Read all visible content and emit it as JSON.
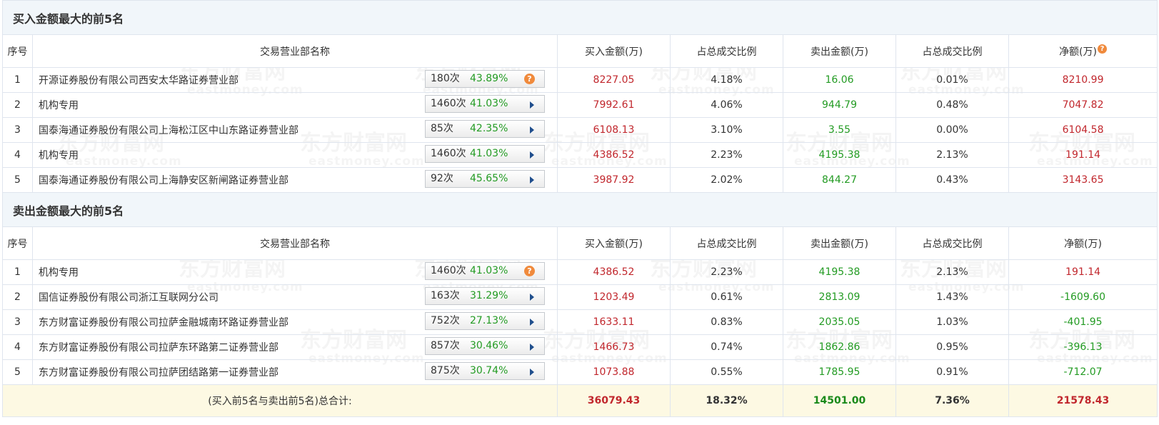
{
  "watermark": {
    "cn": "东方财富网",
    "en": "eastmoney.com"
  },
  "buy_section": {
    "title": "买入金额最大的前5名",
    "headers": [
      "序号",
      "交易营业部名称",
      "买入金额(万)",
      "占总成交比例",
      "卖出金额(万)",
      "占总成交比例",
      "净额(万)"
    ],
    "rows": [
      {
        "rank": "1",
        "name": "开源证券股份有限公司西安太华路证券营业部",
        "count": "180次",
        "pct": "43.89%",
        "btn": "help",
        "buy": "8227.05",
        "buy_ratio": "4.18%",
        "sell": "16.06",
        "sell_ratio": "0.01%",
        "net": "8210.99"
      },
      {
        "rank": "2",
        "name": "机构专用",
        "count": "1460次",
        "pct": "41.03%",
        "btn": "arrow",
        "buy": "7992.61",
        "buy_ratio": "4.06%",
        "sell": "944.79",
        "sell_ratio": "0.48%",
        "net": "7047.82"
      },
      {
        "rank": "3",
        "name": "国泰海通证券股份有限公司上海松江区中山东路证券营业部",
        "count": "85次",
        "pct": "42.35%",
        "btn": "arrow",
        "buy": "6108.13",
        "buy_ratio": "3.10%",
        "sell": "3.55",
        "sell_ratio": "0.00%",
        "net": "6104.58"
      },
      {
        "rank": "4",
        "name": "机构专用",
        "count": "1460次",
        "pct": "41.03%",
        "btn": "arrow",
        "buy": "4386.52",
        "buy_ratio": "2.23%",
        "sell": "4195.38",
        "sell_ratio": "2.13%",
        "net": "191.14"
      },
      {
        "rank": "5",
        "name": "国泰海通证券股份有限公司上海静安区新闸路证券营业部",
        "count": "92次",
        "pct": "45.65%",
        "btn": "arrow",
        "buy": "3987.92",
        "buy_ratio": "2.02%",
        "sell": "844.27",
        "sell_ratio": "0.43%",
        "net": "3143.65"
      }
    ]
  },
  "sell_section": {
    "title": "卖出金额最大的前5名",
    "headers": [
      "序号",
      "交易营业部名称",
      "买入金额(万)",
      "占总成交比例",
      "卖出金额(万)",
      "占总成交比例",
      "净额(万)"
    ],
    "rows": [
      {
        "rank": "1",
        "name": "机构专用",
        "count": "1460次",
        "pct": "41.03%",
        "btn": "help",
        "buy": "4386.52",
        "buy_ratio": "2.23%",
        "sell": "4195.38",
        "sell_ratio": "2.13%",
        "net": "191.14"
      },
      {
        "rank": "2",
        "name": "国信证券股份有限公司浙江互联网分公司",
        "count": "163次",
        "pct": "31.29%",
        "btn": "arrow",
        "buy": "1203.49",
        "buy_ratio": "0.61%",
        "sell": "2813.09",
        "sell_ratio": "1.43%",
        "net": "-1609.60"
      },
      {
        "rank": "3",
        "name": "东方财富证券股份有限公司拉萨金融城南环路证券营业部",
        "count": "752次",
        "pct": "27.13%",
        "btn": "arrow",
        "buy": "1633.11",
        "buy_ratio": "0.83%",
        "sell": "2035.05",
        "sell_ratio": "1.03%",
        "net": "-401.95"
      },
      {
        "rank": "4",
        "name": "东方财富证券股份有限公司拉萨东环路第二证券营业部",
        "count": "857次",
        "pct": "30.46%",
        "btn": "arrow",
        "buy": "1466.73",
        "buy_ratio": "0.74%",
        "sell": "1862.86",
        "sell_ratio": "0.95%",
        "net": "-396.13"
      },
      {
        "rank": "5",
        "name": "东方财富证券股份有限公司拉萨团结路第一证券营业部",
        "count": "875次",
        "pct": "30.74%",
        "btn": "arrow",
        "buy": "1073.88",
        "buy_ratio": "0.55%",
        "sell": "1785.95",
        "sell_ratio": "0.91%",
        "net": "-712.07"
      }
    ]
  },
  "total": {
    "label": "(买入前5名与卖出前5名)总合计:",
    "buy": "36079.43",
    "buy_ratio": "18.32%",
    "sell": "14501.00",
    "sell_ratio": "7.36%",
    "net": "21578.43"
  },
  "colors": {
    "buy": "#c1272d",
    "sell": "#239b23",
    "positive_net": "#c1272d",
    "negative_net": "#239b23",
    "section_bg": "#f1f6fa",
    "total_bg": "#fdf9e3",
    "help_icon": "#f08a3c",
    "arrow_icon": "#1f4e8c"
  },
  "icons": {
    "help": "question-circle-icon",
    "arrow": "play-arrow-icon"
  }
}
